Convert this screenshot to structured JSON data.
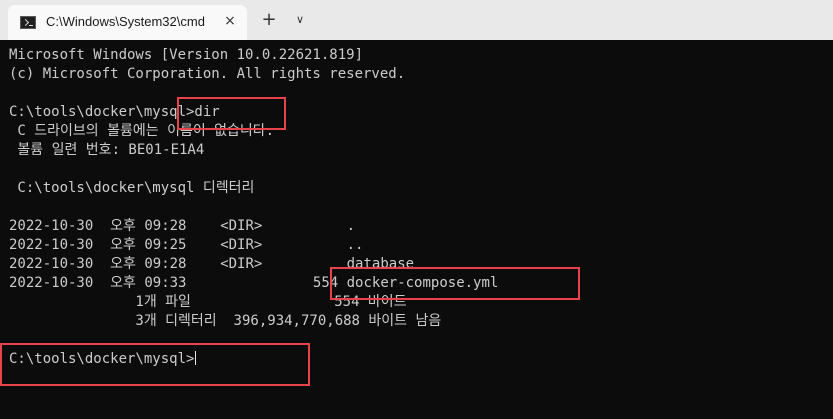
{
  "window": {
    "tab_title": "C:\\Windows\\System32\\cmd",
    "tab_close_glyph": "×",
    "new_tab_glyph": "+",
    "dropdown_glyph": "∨"
  },
  "console": {
    "lines": [
      "Microsoft Windows [Version 10.0.22621.819]",
      "(c) Microsoft Corporation. All rights reserved.",
      "",
      "C:\\tools\\docker\\mysql>dir",
      " C 드라이브의 볼륨에는 이름이 없습니다.",
      " 볼륨 일련 번호: BE01-E1A4",
      "",
      " C:\\tools\\docker\\mysql 디렉터리",
      "",
      "2022-10-30  오후 09:28    <DIR>          .",
      "2022-10-30  오후 09:25    <DIR>          ..",
      "2022-10-30  오후 09:28    <DIR>          database",
      "2022-10-30  오후 09:33               554 docker-compose.yml",
      "               1개 파일                 554 바이트",
      "               3개 디렉터리  396,934,770,688 바이트 남음",
      "",
      "C:\\tools\\docker\\mysql>"
    ]
  },
  "highlight_color": "#e8434b"
}
